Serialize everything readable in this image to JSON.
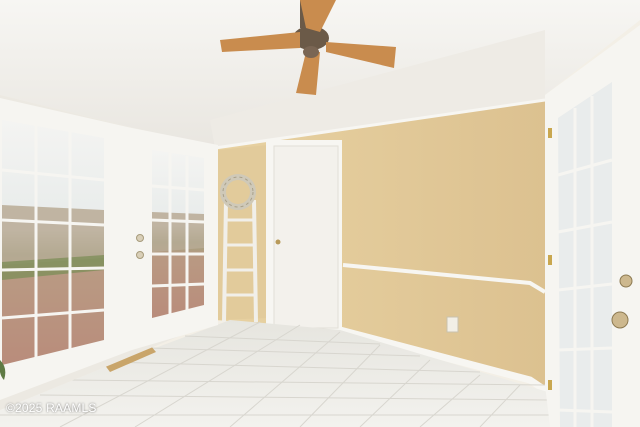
{
  "scene": {
    "description_free": true,
    "watermark_text": "©2025 RAAMLS"
  },
  "colors": {
    "wall_beige": "#e6cf9f",
    "ceiling_white": "#f4f2ee",
    "trim_white": "#f7f6f2",
    "floor_tile": "#ecebe6",
    "fan_blade": "#c98c4e",
    "fan_motor": "#6b5a48"
  }
}
